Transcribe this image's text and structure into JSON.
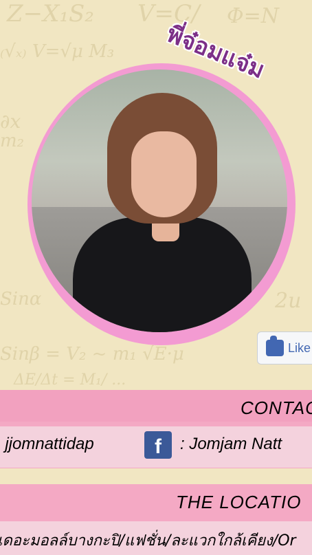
{
  "title": "พี่จ๋อมแจ๋ม",
  "like_button": {
    "label": "Like"
  },
  "contact": {
    "heading": "CONTAC",
    "line_text": ": jjomnattidap",
    "facebook_text": ": Jomjam Natt"
  },
  "location": {
    "heading": "THE LOCATIO",
    "text": "เดอะมอลล์บางกะปิ/แฟชั่น/ละแวกใกล้เคียง/Or"
  },
  "colors": {
    "background": "#f1e6c2",
    "pink_frame": "#f39bd2",
    "band_pink": "#f4a9c4",
    "title_purple": "#7c2f88",
    "facebook_blue": "#3b5998"
  },
  "icons": [
    "facebook-icon",
    "like-thumb-icon"
  ]
}
